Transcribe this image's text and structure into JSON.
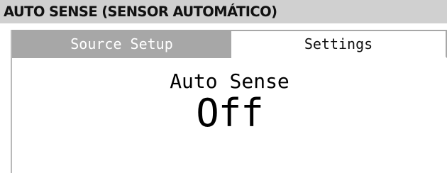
{
  "header": {
    "title": "AUTO SENSE (SENSOR AUTOMÁTICO)"
  },
  "tabs": [
    {
      "label": "Source Setup",
      "active": false
    },
    {
      "label": "Settings",
      "active": true
    }
  ],
  "setting": {
    "label": "Auto Sense",
    "value": "Off"
  },
  "colors": {
    "header_bg": "#d0d0d0",
    "tab_inactive_bg": "#a7a7a7",
    "tab_active_bg": "#ffffff",
    "text": "#000000"
  }
}
